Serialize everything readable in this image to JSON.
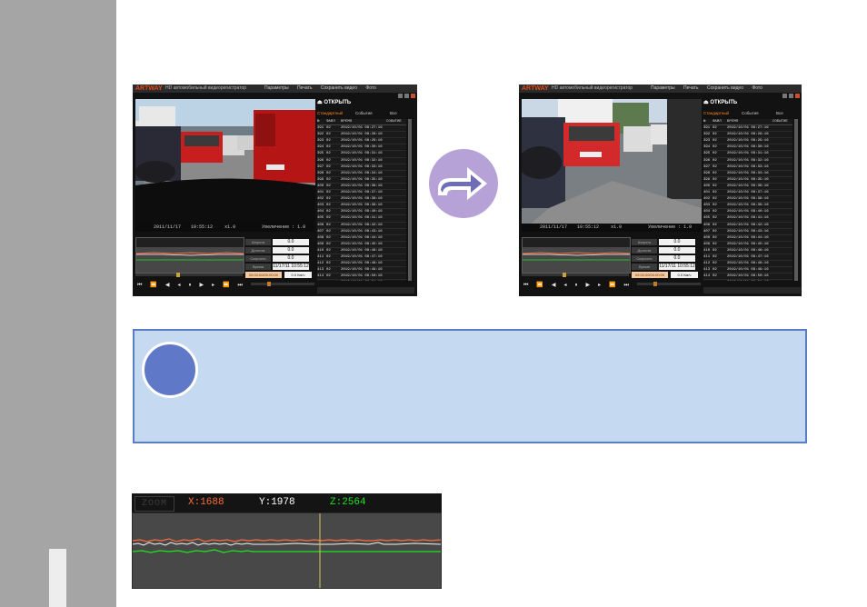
{
  "players": [
    {
      "logo": "ARTWAY",
      "app_title": "HD автомобильный видеорегистратор",
      "menu": [
        "Параметры",
        "Печать",
        "Сохранить видео",
        "Фото"
      ],
      "open_label": "ОТКРЫТЬ",
      "tabs": [
        "Стандартный",
        "События",
        "Все"
      ],
      "list_headers": [
        "№",
        "ФАЙЛ",
        "ВРЕМЯ",
        "СОБЫТИЕ"
      ],
      "rows": [
        [
          "391",
          "02",
          "2019/10/01 08:27:16"
        ],
        [
          "392",
          "02",
          "2019/10/01 08:28:16"
        ],
        [
          "393",
          "02",
          "2019/10/01 08:29:16"
        ],
        [
          "394",
          "02",
          "2019/10/01 08:30:16"
        ],
        [
          "395",
          "02",
          "2019/10/01 08:31:16"
        ],
        [
          "396",
          "02",
          "2019/10/01 08:32:16"
        ],
        [
          "397",
          "02",
          "2019/10/01 08:33:16"
        ],
        [
          "398",
          "02",
          "2019/10/01 08:34:16"
        ],
        [
          "399",
          "02",
          "2019/10/01 08:35:16"
        ],
        [
          "400",
          "02",
          "2019/10/01 08:36:16"
        ],
        [
          "401",
          "02",
          "2019/10/01 08:37:16"
        ],
        [
          "402",
          "02",
          "2019/10/01 08:38:16"
        ],
        [
          "403",
          "02",
          "2019/10/01 08:39:16"
        ],
        [
          "404",
          "02",
          "2019/10/01 08:40:16"
        ],
        [
          "405",
          "02",
          "2019/10/01 08:41:16"
        ],
        [
          "406",
          "02",
          "2019/10/01 08:42:16"
        ],
        [
          "407",
          "02",
          "2019/10/01 08:43:16"
        ],
        [
          "408",
          "02",
          "2019/10/01 08:44:16"
        ],
        [
          "409",
          "02",
          "2019/10/01 08:45:16"
        ],
        [
          "410",
          "02",
          "2019/10/01 08:46:16"
        ],
        [
          "411",
          "02",
          "2019/10/01 08:47:16"
        ],
        [
          "412",
          "02",
          "2019/10/01 08:48:16"
        ],
        [
          "413",
          "02",
          "2019/10/01 08:49:16"
        ],
        [
          "414",
          "02",
          "2019/10/01 08:50:16"
        ],
        [
          "415",
          "02",
          "2019/10/01 08:51:16"
        ],
        [
          "416",
          "02",
          "2019/10/01 08:52:16"
        ],
        [
          "417",
          "02",
          "2019/10/01 08:53:16"
        ]
      ],
      "osd_date": "2011/11/17",
      "osd_time": "10:55:12",
      "osd_speed": "x1.0",
      "osd_zoom": "Увеличение : 1.0",
      "info_labels": [
        "Широта",
        "Долгота",
        "Скорость",
        "Время"
      ],
      "info_values": [
        "0.0",
        "0.0",
        "0.0",
        "11/17/11 10:55:12"
      ],
      "time_display": "00:00:00/00:00:00",
      "speed_display": "0.0 Км/ч"
    },
    {
      "logo": "ARTWAY",
      "app_title": "HD автомобильный видеорегистратор",
      "menu": [
        "Параметры",
        "Печать",
        "Сохранить видео",
        "Фото"
      ],
      "open_label": "ОТКРЫТЬ",
      "tabs": [
        "Стандартный",
        "События",
        "Все"
      ],
      "list_headers": [
        "№",
        "ФАЙЛ",
        "ВРЕМЯ",
        "СОБЫТИЕ"
      ],
      "rows": [
        [
          "391",
          "02",
          "2019/10/01 08:27:16"
        ],
        [
          "392",
          "02",
          "2019/10/01 08:28:16"
        ],
        [
          "393",
          "02",
          "2019/10/01 08:29:16"
        ],
        [
          "394",
          "02",
          "2019/10/01 08:30:16"
        ],
        [
          "395",
          "02",
          "2019/10/01 08:31:16"
        ],
        [
          "396",
          "02",
          "2019/10/01 08:32:16"
        ],
        [
          "397",
          "02",
          "2019/10/01 08:33:16"
        ],
        [
          "398",
          "02",
          "2019/10/01 08:34:16"
        ],
        [
          "399",
          "02",
          "2019/10/01 08:35:16"
        ],
        [
          "400",
          "02",
          "2019/10/01 08:36:16"
        ],
        [
          "401",
          "02",
          "2019/10/01 08:37:16"
        ],
        [
          "402",
          "02",
          "2019/10/01 08:38:16"
        ],
        [
          "403",
          "02",
          "2019/10/01 08:39:16"
        ],
        [
          "404",
          "02",
          "2019/10/01 08:40:16"
        ],
        [
          "405",
          "02",
          "2019/10/01 08:41:16"
        ],
        [
          "406",
          "02",
          "2019/10/01 08:42:16"
        ],
        [
          "407",
          "02",
          "2019/10/01 08:43:16"
        ],
        [
          "408",
          "02",
          "2019/10/01 08:44:16"
        ],
        [
          "409",
          "02",
          "2019/10/01 08:45:16"
        ],
        [
          "410",
          "02",
          "2019/10/01 08:46:16"
        ],
        [
          "411",
          "02",
          "2019/10/01 08:47:16"
        ],
        [
          "412",
          "02",
          "2019/10/01 08:48:16"
        ],
        [
          "413",
          "02",
          "2019/10/01 08:49:16"
        ],
        [
          "414",
          "02",
          "2019/10/01 08:50:16"
        ],
        [
          "415",
          "02",
          "2019/10/01 08:51:16"
        ],
        [
          "416",
          "02",
          "2019/10/01 08:52:16"
        ],
        [
          "417",
          "02",
          "2019/10/01 08:53:16"
        ]
      ],
      "osd_date": "2011/11/17",
      "osd_time": "10:55:12",
      "osd_speed": "x1.0",
      "osd_zoom": "Увеличение : 1.0",
      "info_labels": [
        "Широта",
        "Долгота",
        "Скорость",
        "Время"
      ],
      "info_values": [
        "0.0",
        "0.0",
        "0.0",
        "11/17/11 10:55:12"
      ],
      "time_display": "00:00:00/00:00:00",
      "speed_display": "0.0 Км/ч"
    }
  ],
  "arrow_icon": "right-arrow-icon",
  "note_icon": "info-circle-icon",
  "gsensor": {
    "zoom_label": "ZOOM",
    "x_label": "X:1688",
    "y_label": "Y:1978",
    "z_label": "Z:2564",
    "colors": {
      "x": "#ff6a3d",
      "y": "#ffffff",
      "z": "#1ee61e",
      "cursor": "#d8c35a"
    }
  }
}
